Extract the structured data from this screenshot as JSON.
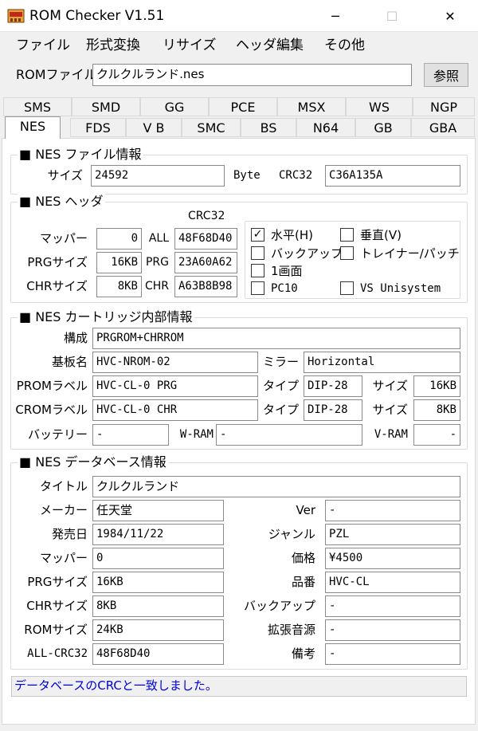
{
  "window": {
    "title": "ROM Checker V1.51",
    "icon": "rom-app-icon",
    "controls": {
      "minimize": "─",
      "maximize": "☐",
      "close": "✕"
    }
  },
  "menu": [
    "ファイル",
    "形式変換",
    "リサイズ",
    "ヘッダ編集",
    "その他"
  ],
  "rom_file": {
    "label": "ROMファイル",
    "value": "クルクルランド.nes",
    "browse": "参照"
  },
  "tabs_row1": [
    "SMS",
    "SMD",
    "GG",
    "PCE",
    "MSX",
    "WS",
    "NGP"
  ],
  "tabs_row2": [
    "NES",
    "FDS",
    "V B",
    "SMC",
    "BS",
    "N64",
    "GB",
    "GBA"
  ],
  "active_tab": "NES",
  "file_info": {
    "title": "■ NES ファイル情報",
    "size_label": "サイズ",
    "size": "24592",
    "unit": "Byte",
    "crc_label": "CRC32",
    "crc": "C36A135A"
  },
  "header": {
    "title": "■ NES ヘッダ",
    "crc_col": "CRC32",
    "mapper_label": "マッパー",
    "mapper": "0",
    "prg_label": "PRGサイズ",
    "prg": "16KB",
    "chr_label": "CHRサイズ",
    "chr": "8KB",
    "all_label": "ALL",
    "all_crc": "48F68D40",
    "prg_crc_label": "PRG",
    "prg_crc": "23A60A62",
    "chr_crc_label": "CHR",
    "chr_crc": "A63B8B98",
    "flags": {
      "horizontal": "水平(H)",
      "vertical": "垂直(V)",
      "backup": "バックアップ",
      "trainer": "トレイナー/パッチ",
      "one_screen": "1画面",
      "pc10": "PC10",
      "vs": "VS Unisystem"
    },
    "check": "✓"
  },
  "cart": {
    "title": "■ NES カートリッジ内部情報",
    "config_label": "構成",
    "config": "PRGROM+CHRROM",
    "board_label": "基板名",
    "board": "HVC-NROM-02",
    "mirror_label": "ミラー",
    "mirror": "Horizontal",
    "prom_label": "PROMラベル",
    "prom": "HVC-CL-0 PRG",
    "crom_label": "CROMラベル",
    "crom": "HVC-CL-0 CHR",
    "type_label": "タイプ",
    "prom_type": "DIP-28",
    "crom_type": "DIP-28",
    "size_label": "サイズ",
    "prom_size": "16KB",
    "crom_size": "8KB",
    "battery_label": "バッテリー",
    "battery": "-",
    "wram_label": "W-RAM",
    "wram": "-",
    "vram_label": "V-RAM",
    "vram": "-"
  },
  "db": {
    "title": "■ NES データベース情報",
    "title_label": "タイトル",
    "title_value": "クルクルランド",
    "maker_label": "メーカー",
    "maker": "任天堂",
    "ver_label": "Ver",
    "ver": "-",
    "date_label": "発売日",
    "date": "1984/11/22",
    "genre_label": "ジャンル",
    "genre": "PZL",
    "mapper_label": "マッパー",
    "mapper": "0",
    "price_label": "価格",
    "price": "¥4500",
    "prg_label": "PRGサイズ",
    "prg": "16KB",
    "code_label": "品番",
    "code": "HVC-CL",
    "chr_label": "CHRサイズ",
    "chr": "8KB",
    "backup_label": "バックアップ",
    "backup": "-",
    "rom_label": "ROMサイズ",
    "rom": "24KB",
    "sound_label": "拡張音源",
    "sound": "-",
    "allcrc_label": "ALL-CRC32",
    "allcrc": "48F68D40",
    "note_label": "備考",
    "note": "-"
  },
  "status": "データベースのCRCと一致しました。"
}
